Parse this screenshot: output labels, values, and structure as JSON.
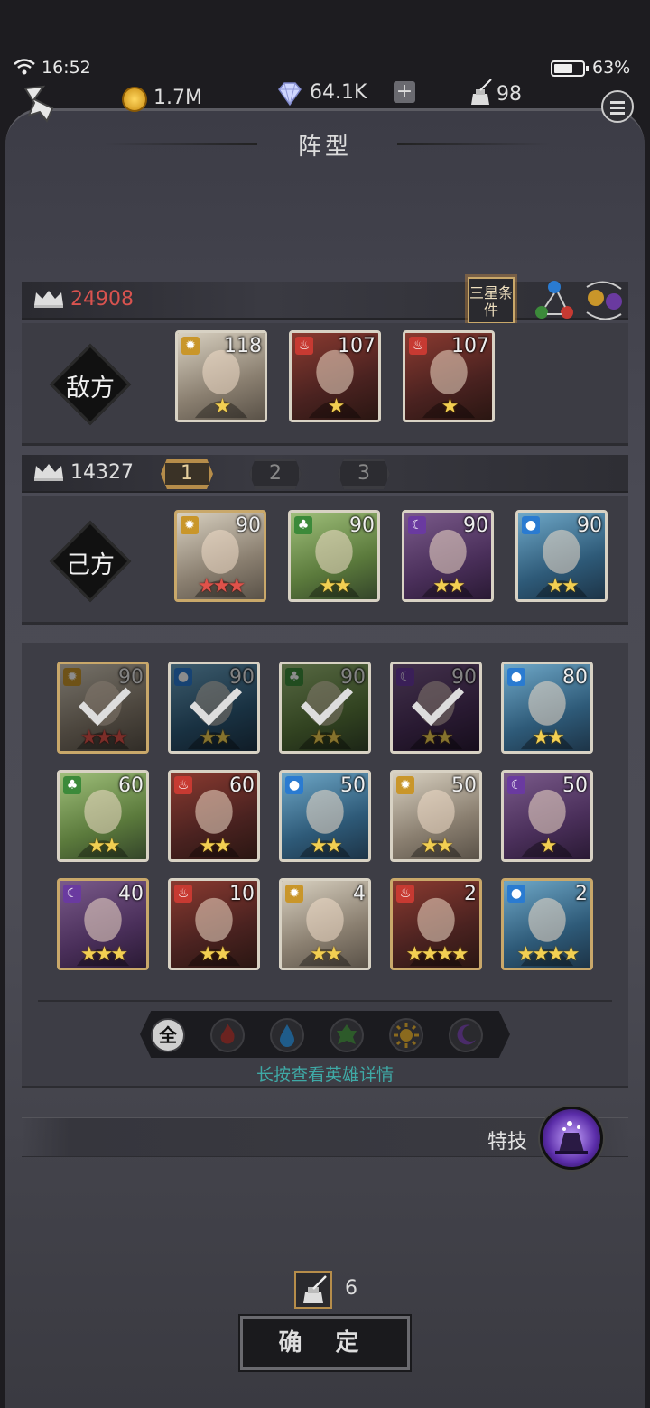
{
  "status": {
    "time": "16:52",
    "battery": "63%"
  },
  "currency": {
    "gold": "1.7M",
    "gems": "64.1K",
    "ink": "98"
  },
  "title": "阵型",
  "enemy": {
    "power": "24908",
    "label": "敌方",
    "star_condition": "三星条件",
    "heroes": [
      {
        "level": "118",
        "element": "light",
        "stars": 1
      },
      {
        "level": "107",
        "element": "fire",
        "stars": 1
      },
      {
        "level": "107",
        "element": "fire",
        "stars": 1
      }
    ]
  },
  "ally": {
    "power": "14327",
    "label": "己方",
    "team_tabs": [
      "1",
      "2",
      "3"
    ],
    "heroes": [
      {
        "level": "90",
        "element": "light",
        "stars": "red3"
      },
      {
        "level": "90",
        "element": "nature",
        "stars": 2
      },
      {
        "level": "90",
        "element": "dark",
        "stars": 2
      },
      {
        "level": "90",
        "element": "water",
        "stars": 2
      }
    ]
  },
  "roster": [
    {
      "level": "90",
      "element": "light",
      "stars": "red3",
      "picked": true
    },
    {
      "level": "90",
      "element": "water",
      "stars": 2,
      "picked": true
    },
    {
      "level": "90",
      "element": "nature",
      "stars": 2,
      "picked": true
    },
    {
      "level": "90",
      "element": "dark",
      "stars": 2,
      "picked": true
    },
    {
      "level": "80",
      "element": "water",
      "stars": 2,
      "picked": false
    },
    {
      "level": "60",
      "element": "nature",
      "stars": 2,
      "picked": false
    },
    {
      "level": "60",
      "element": "fire",
      "stars": 2,
      "picked": false
    },
    {
      "level": "50",
      "element": "water",
      "stars": 2,
      "picked": false
    },
    {
      "level": "50",
      "element": "light",
      "stars": 2,
      "picked": false
    },
    {
      "level": "50",
      "element": "dark",
      "stars": 1,
      "picked": false
    },
    {
      "level": "40",
      "element": "dark",
      "stars": 3,
      "picked": false
    },
    {
      "level": "10",
      "element": "fire",
      "stars": 2,
      "picked": false
    },
    {
      "level": "4",
      "element": "light",
      "stars": 2,
      "picked": false
    },
    {
      "level": "2",
      "element": "fire",
      "stars": 4,
      "picked": false
    },
    {
      "level": "2",
      "element": "water",
      "stars": 4,
      "picked": false
    }
  ],
  "filters": {
    "all_label": "全",
    "items": [
      "fire",
      "water",
      "nature",
      "light",
      "dark"
    ]
  },
  "hint": "长按查看英雄详情",
  "skill_label": "特技",
  "cost": "6",
  "confirm_label": "确 定",
  "colors": {
    "gold": "#c9a86a",
    "hint": "#3fa9a6",
    "enemy_power": "#d9534f",
    "star": "#f2cf52"
  }
}
